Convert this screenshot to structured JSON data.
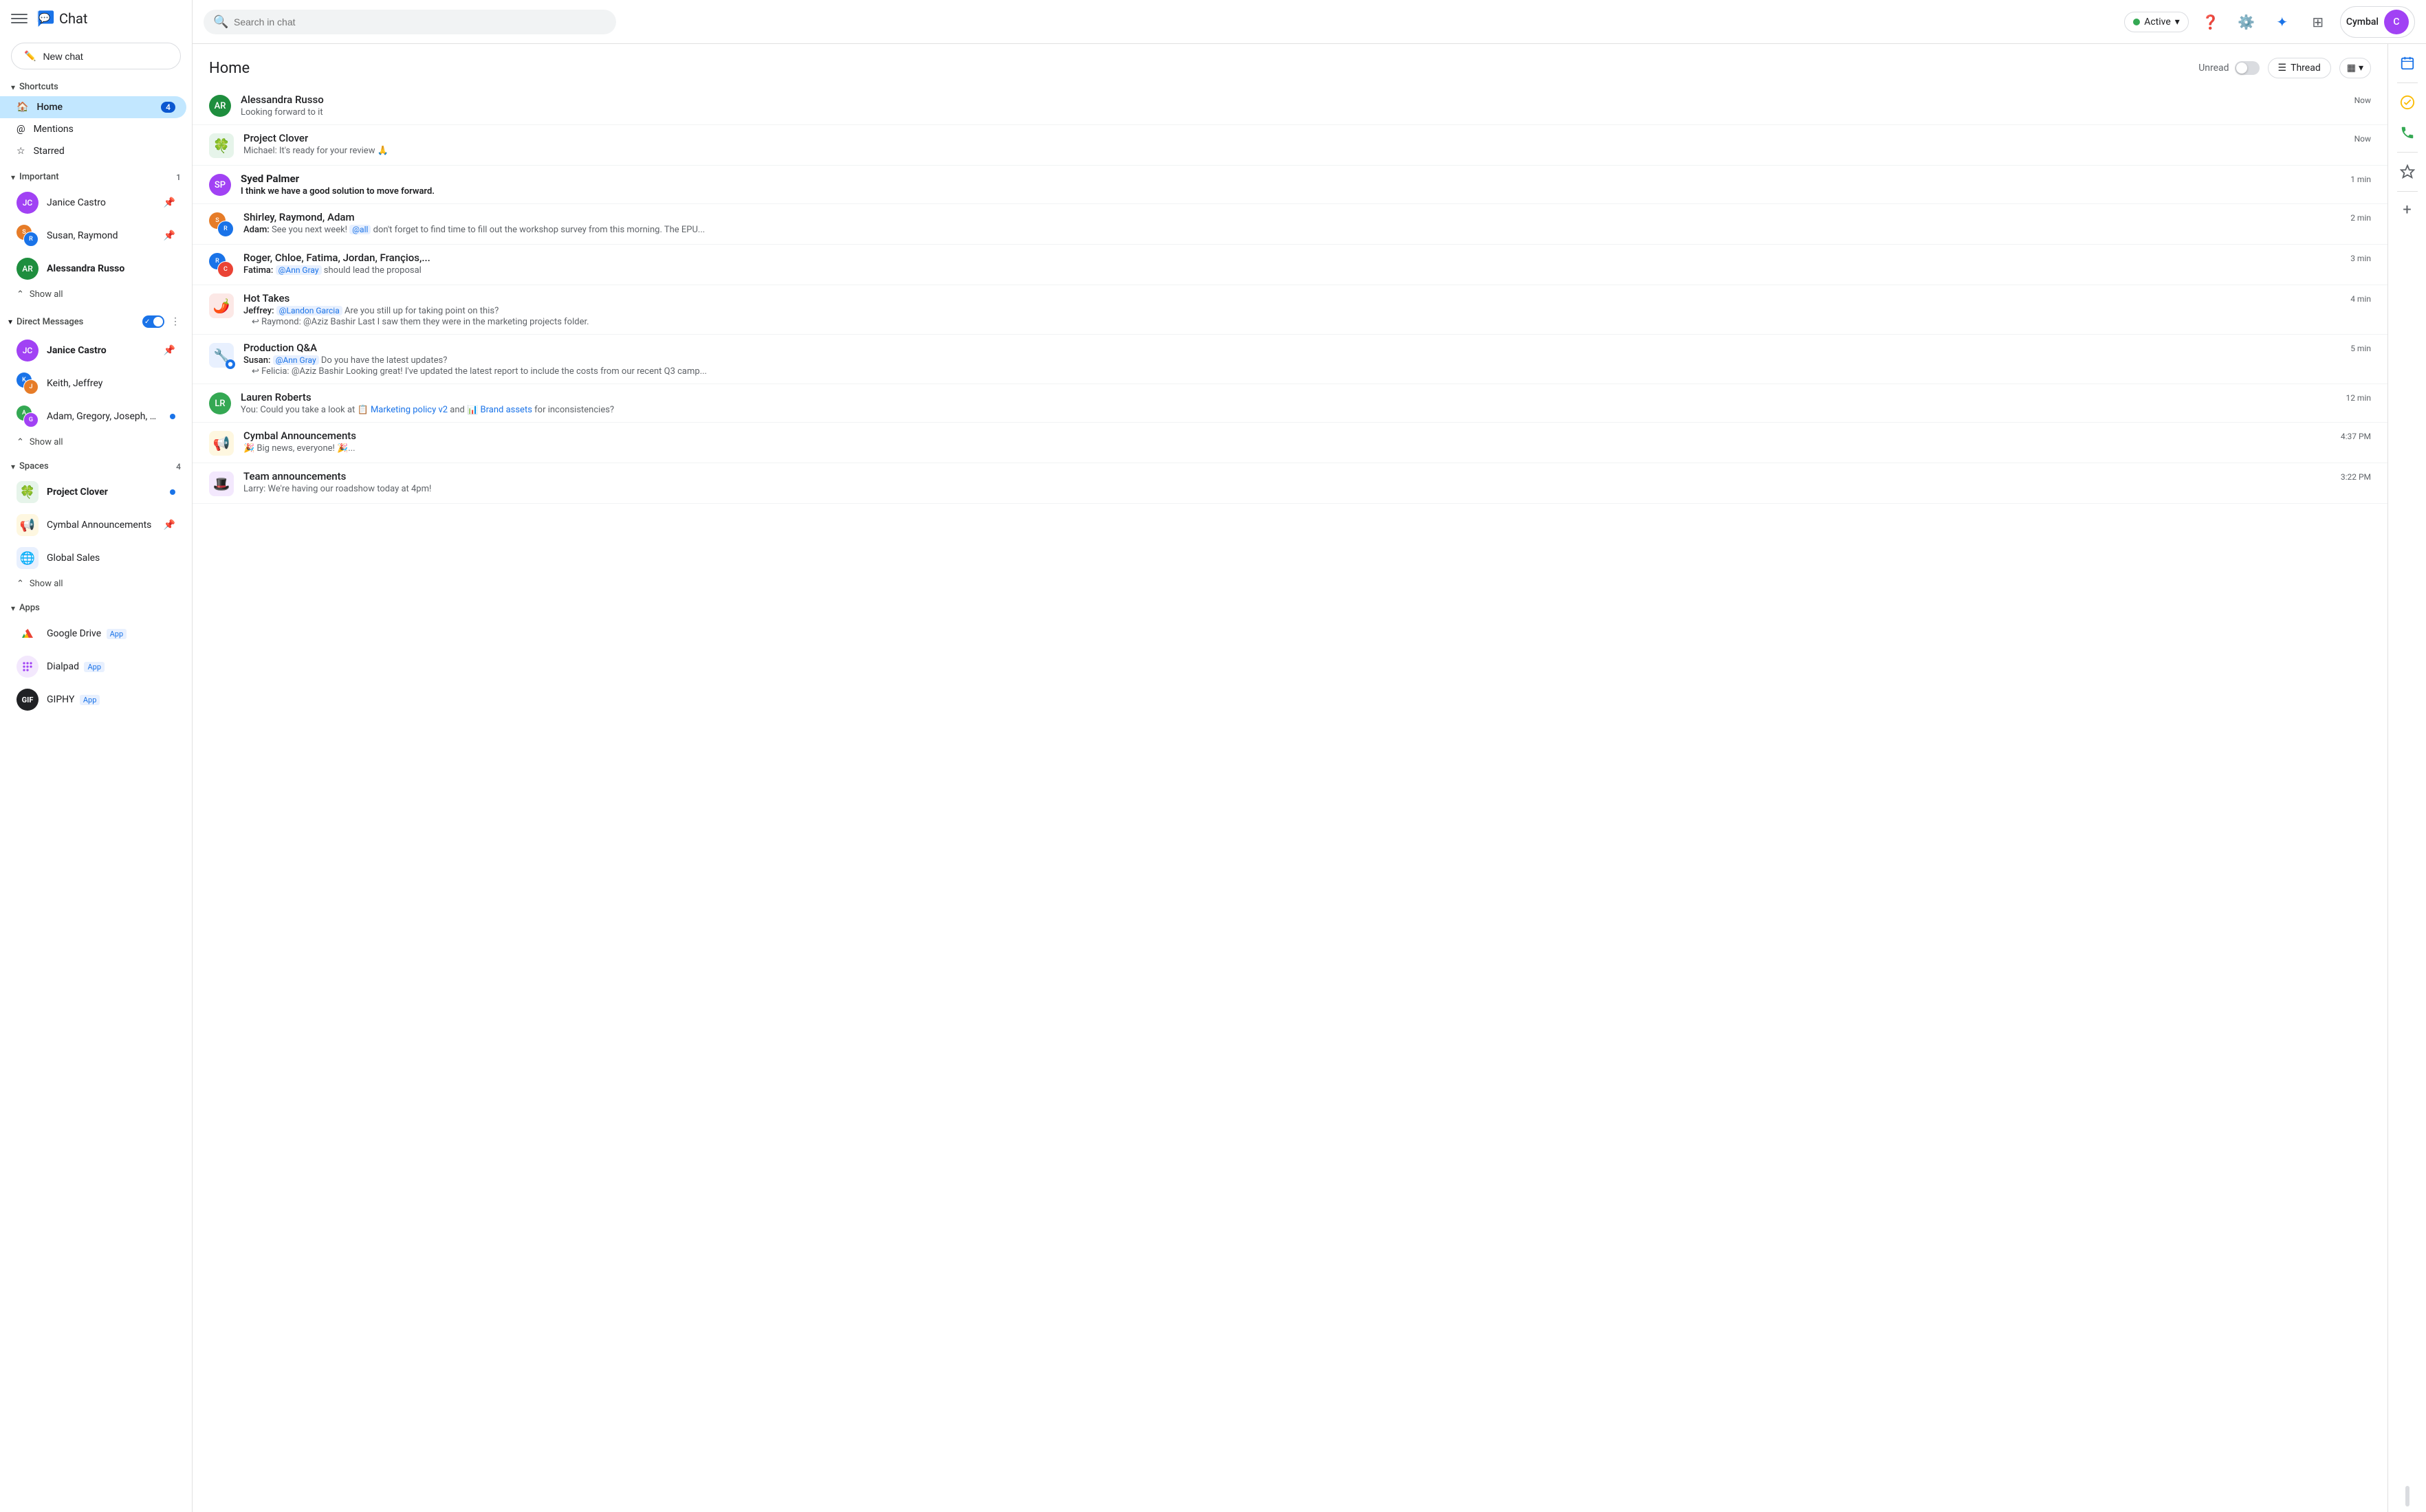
{
  "app": {
    "title": "Chat",
    "logo_text": "Chat"
  },
  "topbar": {
    "search_placeholder": "Search in chat",
    "active_label": "Active",
    "account_name": "Cymbal"
  },
  "sidebar": {
    "new_chat_label": "New chat",
    "shortcuts_label": "Shortcuts",
    "shortcuts_items": [
      {
        "id": "home",
        "label": "Home",
        "badge": "4",
        "active": true
      },
      {
        "id": "mentions",
        "label": "Mentions",
        "badge": "",
        "active": false
      },
      {
        "id": "starred",
        "label": "Starred",
        "badge": "",
        "active": false
      }
    ],
    "important_label": "Important",
    "important_badge": "1",
    "important_items": [
      {
        "id": "janice",
        "label": "Janice Castro",
        "pin": true,
        "initials": "JC",
        "color": "#a142f4"
      },
      {
        "id": "susan-raymond",
        "label": "Susan, Raymond",
        "pin": true,
        "initials": "SR",
        "color": "#e67c28",
        "is_group": true
      },
      {
        "id": "alessandra",
        "label": "Alessandra Russo",
        "pin": false,
        "initials": "AR",
        "color": "#1e8e3e"
      }
    ],
    "important_show_all": "Show all",
    "dm_label": "Direct Messages",
    "dm_items": [
      {
        "id": "janice-dm",
        "label": "Janice Castro",
        "pin": true,
        "initials": "JC",
        "color": "#a142f4"
      },
      {
        "id": "keith-jeffrey",
        "label": "Keith, Jeffrey",
        "pin": false,
        "initials": "KJ",
        "color": "#1a73e8",
        "is_group": true
      },
      {
        "id": "adam-gregory",
        "label": "Adam, Gregory, Joseph, Jani...",
        "dot": true,
        "initials": "AG",
        "color": "#34a853",
        "is_group": true
      }
    ],
    "dm_show_all": "Show all",
    "spaces_label": "Spaces",
    "spaces_badge": "4",
    "spaces_items": [
      {
        "id": "project-clover",
        "label": "Project Clover",
        "dot": true,
        "emoji": "🍀"
      },
      {
        "id": "cymbal-announcements",
        "label": "Cymbal Announcements",
        "pin": true,
        "emoji": "📢"
      },
      {
        "id": "global-sales",
        "label": "Global Sales",
        "emoji": "🌐"
      }
    ],
    "spaces_show_all": "Show all",
    "apps_label": "Apps",
    "apps_items": [
      {
        "id": "google-drive",
        "label": "Google Drive",
        "tag": "App",
        "color": "#fbbc04"
      },
      {
        "id": "dialpad",
        "label": "Dialpad",
        "tag": "App",
        "color": "#a142f4"
      },
      {
        "id": "giphy",
        "label": "GIPHY",
        "tag": "App",
        "color": "#202124"
      }
    ]
  },
  "home": {
    "title": "Home",
    "unread_label": "Unread",
    "thread_label": "Thread",
    "messages": [
      {
        "id": "alessandra-russo",
        "name": "Alessandra Russo",
        "time": "Now",
        "preview": "Looking forward to it",
        "initials": "AR",
        "color": "#1e8e3e",
        "avatar_type": "single"
      },
      {
        "id": "project-clover",
        "name": "Project Clover",
        "time": "Now",
        "preview": "Michael: It's ready for your review 🙏",
        "emoji": "🍀",
        "avatar_type": "emoji",
        "bg": "#e6f4ea"
      },
      {
        "id": "syed-palmer",
        "name": "Syed Palmer",
        "time": "1 min",
        "preview": "I think we have a good solution to move forward.",
        "initials": "SP",
        "color": "#a142f4",
        "avatar_type": "single"
      },
      {
        "id": "shirley-raymond-adam",
        "name": "Shirley, Raymond, Adam",
        "time": "2 min",
        "preview": "Adam: See you next week! @all  don't forget to find time to fill out the workshop survey from this morning. The EPU...",
        "initials": "SRA",
        "color": "#e67c28",
        "avatar_type": "group"
      },
      {
        "id": "roger-group",
        "name": "Roger, Chloe, Fatima, Jordan, Françios,...",
        "time": "3 min",
        "preview": "Fatima: @Ann Gray should lead the proposal",
        "initials": "RC",
        "color": "#1a73e8",
        "avatar_type": "group"
      },
      {
        "id": "hot-takes",
        "name": "Hot Takes",
        "time": "4 min",
        "preview": "Jeffrey: @Landon Garcia Are you still up for taking point on this?",
        "preview2": "Raymond: @Aziz Bashir Last I saw them they were in the marketing projects folder.",
        "emoji": "🌶️",
        "avatar_type": "emoji",
        "bg": "#fce8e6"
      },
      {
        "id": "production-qa",
        "name": "Production Q&A",
        "time": "5 min",
        "preview": "Susan: @Ann Gray Do you have the latest updates?",
        "preview2": "Felicia: @Aziz Bashir Looking great! I've updated the latest report to include the costs from our recent Q3 camp...",
        "emoji": "🔧",
        "avatar_type": "emoji",
        "bg": "#e8f0fe"
      },
      {
        "id": "lauren-roberts",
        "name": "Lauren Roberts",
        "time": "12 min",
        "preview": "You: Could you take a look at 📋 Marketing policy v2 and 📊 Brand assets for inconsistencies?",
        "initials": "LR",
        "color": "#34a853",
        "avatar_type": "single"
      },
      {
        "id": "cymbal-announcements",
        "name": "Cymbal Announcements",
        "time": "4:37 PM",
        "preview": "🎉 Big news, everyone! 🎉...",
        "emoji": "📢",
        "avatar_type": "emoji",
        "bg": "#fef7e0"
      },
      {
        "id": "team-announcements",
        "name": "Team announcements",
        "time": "3:22 PM",
        "preview": "Larry: We're having our roadshow today at 4pm!",
        "emoji": "🎩",
        "avatar_type": "emoji",
        "bg": "#f3e8fd"
      }
    ]
  },
  "mini_panel": {
    "icons": [
      "calendar",
      "task",
      "phone",
      "bookmark",
      "add"
    ]
  }
}
